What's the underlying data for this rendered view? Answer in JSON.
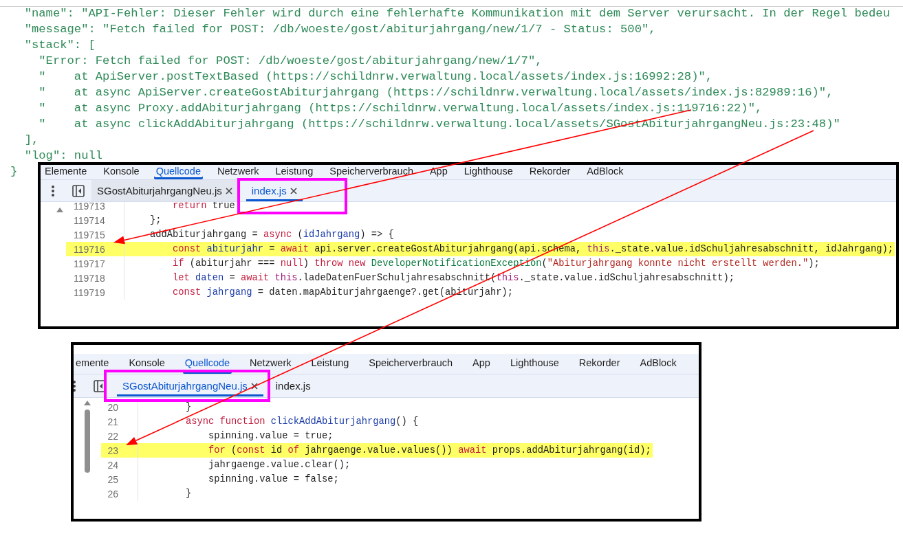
{
  "json_view": {
    "lines": [
      "  \"name\": \"API-Fehler: Dieser Fehler wird durch eine fehlerhafte Kommunikation mit dem Server verursacht. In der Regel bedeu",
      "  \"message\": \"Fetch failed for POST: /db/woeste/gost/abiturjahrgang/new/1/7 - Status: 500\",",
      "  \"stack\": [",
      "    \"Error: Fetch failed for POST: /db/woeste/gost/abiturjahrgang/new/1/7\",",
      "    \"    at ApiServer.postTextBased (https://schildnrw.verwaltung.local/assets/index.js:16992:28)\",",
      "    \"    at async ApiServer.createGostAbiturjahrgang (https://schildnrw.verwaltung.local/assets/index.js:82989:16)\",",
      "    \"    at async Proxy.addAbiturjahrgang (https://schildnrw.verwaltung.local/assets/index.js:119716:22)\",",
      "    \"    at async clickAddAbiturjahrgang (https://schildnrw.verwaltung.local/assets/SGostAbiturjahrgangNeu.js:23:48)\"",
      "  ],",
      "  \"log\": null",
      "}"
    ]
  },
  "devtools_panels": [
    {
      "tabs": [
        {
          "label": "Elemente",
          "selected": false
        },
        {
          "label": "Konsole",
          "selected": false
        },
        {
          "label": "Quellcode",
          "selected": true
        },
        {
          "label": "Netzwerk",
          "selected": false
        },
        {
          "label": "Leistung",
          "selected": false
        },
        {
          "label": "Speicherverbrauch",
          "selected": false
        },
        {
          "label": "App",
          "selected": false
        },
        {
          "label": "Lighthouse",
          "selected": false
        },
        {
          "label": "Rekorder",
          "selected": false
        },
        {
          "label": "AdBlock",
          "selected": false
        }
      ],
      "file_tabs": [
        {
          "label": "SGostAbiturjahrgangNeu.js",
          "selected": false,
          "closable": true
        },
        {
          "label": "index.js",
          "selected": true,
          "closable": true
        }
      ],
      "code_lines": [
        {
          "number": "119713",
          "highlighted": false,
          "tokens": [
            {
              "text": "        return",
              "kind": "keyword"
            },
            {
              "text": " true",
              "kind": "plain"
            }
          ]
        },
        {
          "number": "119714",
          "highlighted": false,
          "tokens": [
            {
              "text": "    };",
              "kind": "plain"
            }
          ]
        },
        {
          "number": "119715",
          "highlighted": false,
          "tokens": [
            {
              "text": "    addAbiturjahrgang = ",
              "kind": "plain"
            },
            {
              "text": "async",
              "kind": "keyword"
            },
            {
              "text": " (",
              "kind": "plain"
            },
            {
              "text": "idJahrgang",
              "kind": "variable"
            },
            {
              "text": ") => {",
              "kind": "plain"
            }
          ]
        },
        {
          "number": "119716",
          "highlighted": true,
          "tokens": [
            {
              "text": "        const",
              "kind": "keyword"
            },
            {
              "text": " abiturjahr",
              "kind": "variable"
            },
            {
              "text": " = ",
              "kind": "plain"
            },
            {
              "text": "await",
              "kind": "keyword"
            },
            {
              "text": " api.server.createGostAbiturjahrgang(api.schema, ",
              "kind": "plain"
            },
            {
              "text": "this",
              "kind": "this"
            },
            {
              "text": "._state.value.idSchuljahresabschnitt, idJahrgang);",
              "kind": "plain"
            }
          ]
        },
        {
          "number": "119717",
          "highlighted": false,
          "tokens": [
            {
              "text": "        if",
              "kind": "keyword"
            },
            {
              "text": " (abiturjahr === ",
              "kind": "plain"
            },
            {
              "text": "null",
              "kind": "keyword"
            },
            {
              "text": ") ",
              "kind": "plain"
            },
            {
              "text": "throw",
              "kind": "keyword"
            },
            {
              "text": " new",
              "kind": "keyword"
            },
            {
              "text": " DeveloperNotificationException",
              "kind": "type"
            },
            {
              "text": "(",
              "kind": "plain"
            },
            {
              "text": "\"Abiturjahrgang konnte nicht erstellt werden.\"",
              "kind": "string"
            },
            {
              "text": ");",
              "kind": "plain"
            }
          ]
        },
        {
          "number": "119718",
          "highlighted": false,
          "tokens": [
            {
              "text": "        let",
              "kind": "keyword"
            },
            {
              "text": " daten",
              "kind": "variable"
            },
            {
              "text": " = ",
              "kind": "plain"
            },
            {
              "text": "await",
              "kind": "keyword"
            },
            {
              "text": " this",
              "kind": "this"
            },
            {
              "text": ".ladeDatenFuerSchuljahresabschnitt(",
              "kind": "plain"
            },
            {
              "text": "this",
              "kind": "this"
            },
            {
              "text": "._state.value.idSchuljahresabschnitt);",
              "kind": "plain"
            }
          ]
        },
        {
          "number": "119719",
          "highlighted": false,
          "tokens": [
            {
              "text": "        const",
              "kind": "keyword"
            },
            {
              "text": " jahrgang",
              "kind": "variable"
            },
            {
              "text": " = daten.mapAbiturjahrgaenge?.get(abiturjahr);",
              "kind": "plain"
            }
          ]
        }
      ]
    },
    {
      "tabs": [
        {
          "label": "emente",
          "selected": false
        },
        {
          "label": "Konsole",
          "selected": false
        },
        {
          "label": "Quellcode",
          "selected": true
        },
        {
          "label": "Netzwerk",
          "selected": false
        },
        {
          "label": "Leistung",
          "selected": false
        },
        {
          "label": "Speicherverbrauch",
          "selected": false
        },
        {
          "label": "App",
          "selected": false
        },
        {
          "label": "Lighthouse",
          "selected": false
        },
        {
          "label": "Rekorder",
          "selected": false
        },
        {
          "label": "AdBlock",
          "selected": false
        }
      ],
      "file_tabs": [
        {
          "label": "SGostAbiturjahrgangNeu.js",
          "selected": true,
          "closable": true
        },
        {
          "label": "index.js",
          "selected": false,
          "closable": false
        }
      ],
      "code_lines": [
        {
          "number": "20",
          "highlighted": false,
          "tokens": [
            {
              "text": "    }",
              "kind": "plain"
            }
          ]
        },
        {
          "number": "21",
          "highlighted": false,
          "tokens": [
            {
              "text": "    async",
              "kind": "keyword"
            },
            {
              "text": " function",
              "kind": "keyword"
            },
            {
              "text": " clickAddAbiturjahrgang",
              "kind": "variable"
            },
            {
              "text": "() {",
              "kind": "plain"
            }
          ]
        },
        {
          "number": "22",
          "highlighted": false,
          "tokens": [
            {
              "text": "        spinning.value = true;",
              "kind": "plain"
            }
          ]
        },
        {
          "number": "23",
          "highlighted": true,
          "tokens": [
            {
              "text": "        for",
              "kind": "keyword"
            },
            {
              "text": " (",
              "kind": "plain"
            },
            {
              "text": "const",
              "kind": "keyword"
            },
            {
              "text": " id ",
              "kind": "plain"
            },
            {
              "text": "of",
              "kind": "keyword"
            },
            {
              "text": " jahrgaenge.value.values()) ",
              "kind": "plain"
            },
            {
              "text": "await",
              "kind": "keyword"
            },
            {
              "text": " props.addAbiturjahrgang(id);",
              "kind": "plain"
            }
          ]
        },
        {
          "number": "24",
          "highlighted": false,
          "tokens": [
            {
              "text": "        jahrgaenge.value.clear();",
              "kind": "plain"
            }
          ]
        },
        {
          "number": "25",
          "highlighted": false,
          "tokens": [
            {
              "text": "        spinning.value = false;",
              "kind": "plain"
            }
          ]
        },
        {
          "number": "26",
          "highlighted": false,
          "tokens": [
            {
              "text": "    }",
              "kind": "plain"
            }
          ]
        }
      ]
    }
  ]
}
